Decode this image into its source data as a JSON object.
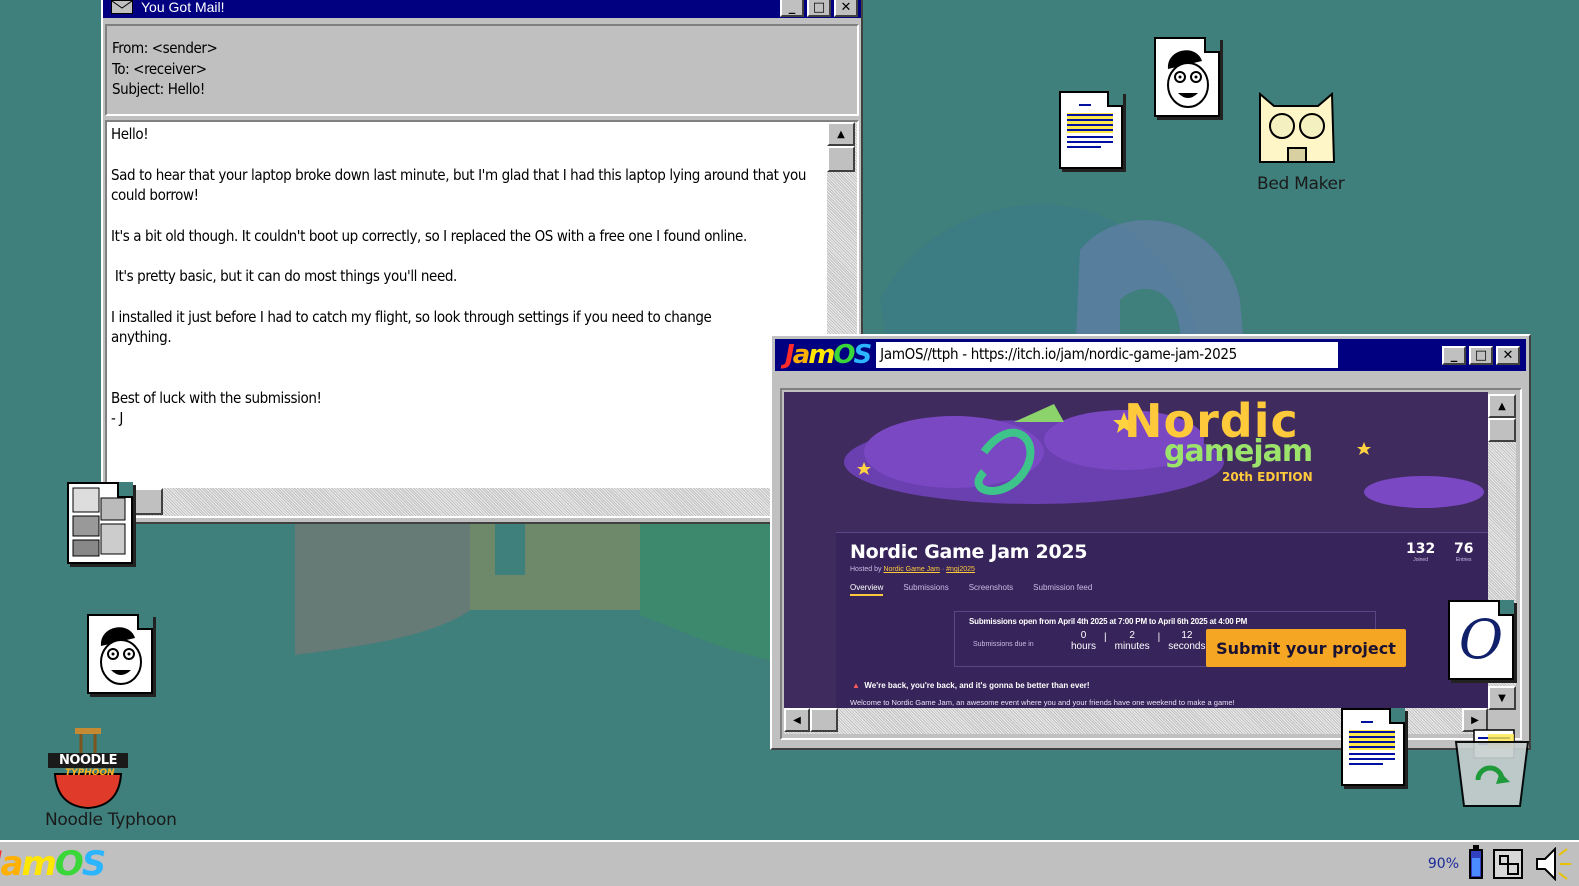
{
  "colors": {
    "desktop": "#3f7f7c",
    "titlebar": "#000080",
    "site_bg": "#3f2b5e",
    "cta": "#f5a623"
  },
  "mail_window": {
    "title": "You Got Mail!",
    "from": "From: <sender>",
    "to": "To: <receiver>",
    "subject": "Subject: Hello!",
    "body": [
      "Hello!",
      "",
      "Sad to hear that your laptop broke down last minute, but I'm glad that I had this laptop lying around that you could borrow!",
      "It's a bit old though. It couldn't boot up correctly, so I replaced the OS with a free one I found online.",
      " It's pretty basic, but it can do most things you'll need.",
      "I installed it just before I had to catch my flight, so look through settings if you need to change anything.",
      "",
      "Best of luck with the submission!\n- J"
    ]
  },
  "browser": {
    "logo": "JamOS",
    "address": "JamOS//ttph - https://itch.io/jam/nordic-game-jam-2025",
    "page": {
      "banner_word1": "Nordic",
      "banner_word2": "gamejam",
      "banner_edition": "20th EDITION",
      "title": "Nordic Game Jam 2025",
      "hosted_prefix": "Hosted by",
      "host": "Nordic Game Jam",
      "tag": "#ngj2025",
      "joined_count": "132",
      "joined_label": "Joined",
      "entries_count": "76",
      "entries_label": "Entries",
      "tabs": [
        "Overview",
        "Submissions",
        "Screenshots",
        "Submission feed"
      ],
      "submissions_open": "Submissions open from April 4th 2025 at 7:00 PM to April 6th 2025 at 4:00 PM",
      "due_label": "Submissions due in",
      "countdown": [
        {
          "value": "0",
          "unit": "hours"
        },
        {
          "value": "2",
          "unit": "minutes"
        },
        {
          "value": "12",
          "unit": "seconds"
        }
      ],
      "cta": "Submit your project",
      "notice": "We're back, you're back, and it's gonna be better than ever!",
      "welcome": "Welcome to Nordic Game Jam, an awesome event where you and your friends have one weekend to make a game!"
    }
  },
  "desktop_icons": {
    "bed_maker": "Bed Maker",
    "noodle_typhoon": "Noodle Typhoon",
    "noodle_logo_line1": "NOODLE",
    "noodle_logo_line2": "TYPHOON",
    "opera_glyph": "O"
  },
  "taskbar": {
    "start_logo": "JamOS",
    "battery": "90%"
  }
}
